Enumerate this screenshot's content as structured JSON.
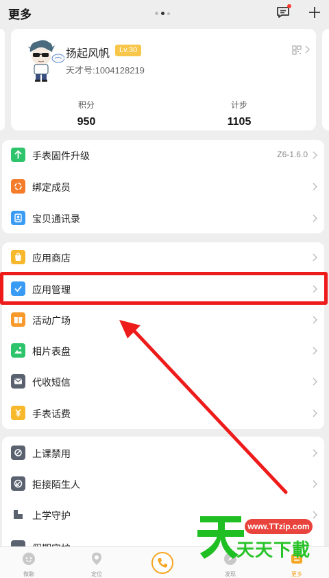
{
  "header": {
    "title": "更多"
  },
  "profile": {
    "name": "扬起风帆",
    "level": "Lv.30",
    "id_text": "天才号:1004128219",
    "stats": [
      {
        "label": "积分",
        "value": "950"
      },
      {
        "label": "计步",
        "value": "1105"
      }
    ]
  },
  "section1": [
    {
      "label": "手表固件升级",
      "value": "Z6-1.6.0",
      "icon": "upgrade-icon",
      "color": "#2ec46b"
    },
    {
      "label": "绑定成员",
      "icon": "members-icon",
      "color": "#f57c2b"
    },
    {
      "label": "宝贝通讯录",
      "icon": "contacts-icon",
      "color": "#3a9bf4"
    }
  ],
  "section2": [
    {
      "label": "应用商店",
      "icon": "store-icon",
      "color": "#f7b92b"
    },
    {
      "label": "应用管理",
      "icon": "app-manage-icon",
      "color": "#3a9bf4"
    },
    {
      "label": "活动广场",
      "icon": "gift-icon",
      "color": "#f79a2b"
    },
    {
      "label": "相片表盘",
      "icon": "photo-icon",
      "color": "#2ec46b"
    },
    {
      "label": "代收短信",
      "icon": "sms-icon",
      "color": "#5a6270"
    },
    {
      "label": "手表话费",
      "icon": "yen-icon",
      "color": "#f7b92b"
    }
  ],
  "section3": [
    {
      "label": "上课禁用",
      "icon": "class-disable-icon",
      "color": "#5a6270"
    },
    {
      "label": "拒接陌生人",
      "icon": "reject-icon",
      "color": "#5a6270"
    },
    {
      "label": "上学守护",
      "icon": "school-guard-icon",
      "color": "#5a6270"
    },
    {
      "label": "假期守护",
      "icon": "holiday-guard-icon",
      "color": "#5a6270"
    }
  ],
  "nav": [
    {
      "label": "微聊",
      "icon": "chat-icon"
    },
    {
      "label": "定位",
      "icon": "location-icon"
    },
    {
      "label": "",
      "icon": "phone-icon"
    },
    {
      "label": "发现",
      "icon": "discover-icon"
    },
    {
      "label": "更多",
      "icon": "more-icon"
    }
  ],
  "watermark": {
    "url": "www.TTzip.com",
    "brand": "天天下載",
    "big_char": "天"
  }
}
